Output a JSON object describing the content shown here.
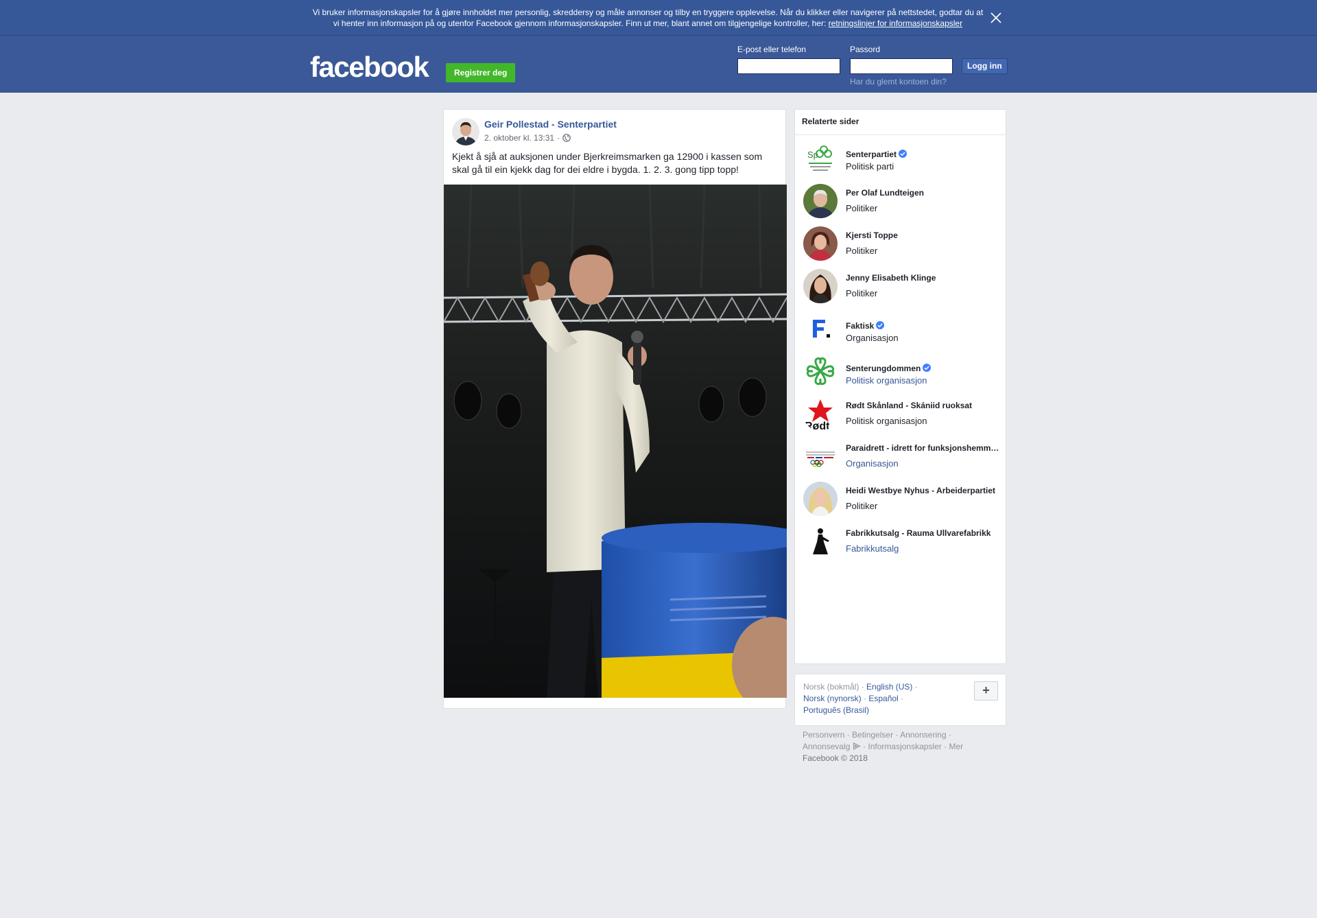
{
  "cookie": {
    "text_1": "Vi bruker informasjonskapsler for å gjøre innholdet mer personlig, skreddersy og måle annonser og tilby en tryggere opplevelse. Når du klikker eller navigerer på nettstedet, godtar du at vi henter inn informasjon på og utenfor Facebook gjennom informasjonskapsler. Finn ut mer, blant annet om tilgjengelige kontroller, her: ",
    "link": "retningslinjer for informasjonskapsler"
  },
  "header": {
    "logo": "facebook",
    "register_label": "Registrer deg",
    "email_label": "E-post eller telefon",
    "password_label": "Passord",
    "login_label": "Logg inn",
    "forgot_label": "Har du glemt kontoen din?"
  },
  "post": {
    "author": "Geir Pollestad - Senterpartiet",
    "timestamp": "2. oktober kl. 13:31",
    "separator": "·",
    "text": "Kjekt å sjå at auksjonen under Bjerkreimsmarken ga 12900 i kassen som skal gå til ein kjekk dag for dei eldre i bygda. 1. 2. 3. gong tipp topp!"
  },
  "related": {
    "title": "Relaterte sider",
    "items": [
      {
        "name": "Senterpartiet",
        "category": "Politisk parti",
        "verified": true,
        "link": false
      },
      {
        "name": "Per Olaf Lundteigen",
        "category": "Politiker",
        "verified": false,
        "link": false
      },
      {
        "name": "Kjersti Toppe",
        "category": "Politiker",
        "verified": false,
        "link": false
      },
      {
        "name": "Jenny Elisabeth Klinge",
        "category": "Politiker",
        "verified": false,
        "link": false
      },
      {
        "name": "Faktisk",
        "category": "Organisasjon",
        "verified": true,
        "link": false
      },
      {
        "name": "Senterungdommen",
        "category": "Politisk organisasjon",
        "verified": true,
        "link": true
      },
      {
        "name": "Rødt Skånland - Skániid ruoksat",
        "category": "Politisk organisasjon",
        "verified": false,
        "link": false
      },
      {
        "name": "Paraidrett - idrett for funksjonshemmede",
        "category": "Organisasjon",
        "verified": false,
        "link": true
      },
      {
        "name": "Heidi Westbye Nyhus - Arbeiderpartiet",
        "category": "Politiker",
        "verified": false,
        "link": false
      },
      {
        "name": "Fabrikkutsalg - Rauma Ullvarefabrikk",
        "category": "Fabrikkutsalg",
        "verified": false,
        "link": true
      }
    ]
  },
  "languages": {
    "current": "Norsk (bokmål)",
    "l1": "English (US)",
    "l2": "Norsk (nynorsk)",
    "l3": "Español",
    "l4": "Português (Brasil)",
    "sep": " · ",
    "plus": "+"
  },
  "footer": {
    "f1": "Personvern",
    "f2": "Betingelser",
    "f3": "Annonsering",
    "f4": "Annonsevalg",
    "f5": "Informasjonskapsler",
    "f6": "Mer",
    "copyright": "Facebook © 2018"
  },
  "colors": {
    "brand": "#3b5998",
    "banner": "#365899",
    "register": "#42b72a",
    "link": "#365899",
    "verified": "#4080ff"
  }
}
